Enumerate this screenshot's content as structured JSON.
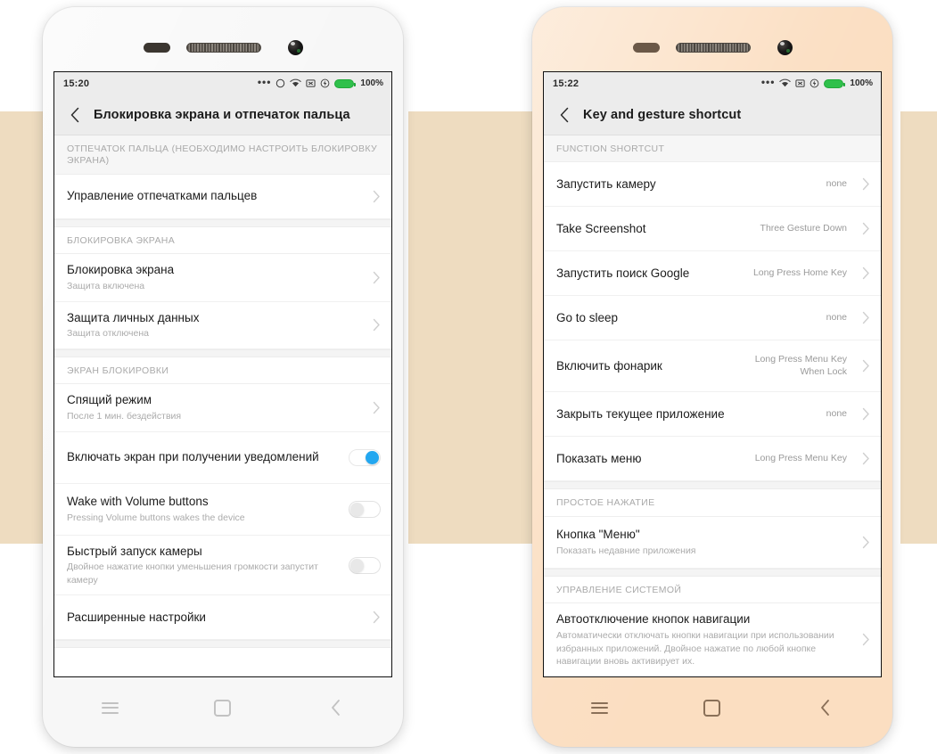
{
  "phones": [
    {
      "id": "left",
      "frame_color": "#f7f7f7",
      "status_bar": {
        "time": "15:20",
        "battery_percent": "100%",
        "icons": [
          "more-dots-icon",
          "alarm-circle-icon",
          "wifi-icon",
          "no-sim-icon",
          "charging-bolt-icon",
          "battery-icon"
        ]
      },
      "title": "Блокировка экрана и отпечаток пальца",
      "back_label": "back-chevron",
      "sections": [
        {
          "header": "ОТПЕЧАТОК ПАЛЬЦА (НЕОБХОДИМО НАСТРОИТЬ БЛОКИРОВКУ ЭКРАНА)",
          "rows": [
            {
              "title": "Управление отпечатками пальцев",
              "sub": "",
              "value": "",
              "control": "chevron"
            }
          ]
        },
        {
          "header": "БЛОКИРОВКА ЭКРАНА",
          "rows": [
            {
              "title": "Блокировка экрана",
              "sub": "Защита включена",
              "value": "",
              "control": "chevron"
            },
            {
              "title": "Защита личных данных",
              "sub": "Защита отключена",
              "value": "",
              "control": "chevron"
            }
          ]
        },
        {
          "header": "ЭКРАН БЛОКИРОВКИ",
          "rows": [
            {
              "title": "Спящий режим",
              "sub": "После 1 мин. бездействия",
              "value": "",
              "control": "chevron"
            },
            {
              "title": "Включать экран при получении уведомлений",
              "sub": "",
              "value": "",
              "control": "toggle-on"
            },
            {
              "title": "Wake with Volume buttons",
              "sub": "Pressing Volume buttons wakes the device",
              "value": "",
              "control": "toggle-off"
            },
            {
              "title": "Быстрый запуск камеры",
              "sub": "Двойное нажатие кнопки уменьшения громкости запустит камеру",
              "value": "",
              "control": "toggle-off"
            },
            {
              "title": "Расширенные настройки",
              "sub": "",
              "value": "",
              "control": "chevron"
            }
          ]
        }
      ],
      "nav": {
        "menu": "menu-icon",
        "home": "home-icon",
        "back": "back-icon"
      }
    },
    {
      "id": "right",
      "frame_color": "#fbdec1",
      "status_bar": {
        "time": "15:22",
        "battery_percent": "100%",
        "icons": [
          "more-dots-icon",
          "wifi-icon",
          "no-sim-icon",
          "charging-bolt-icon",
          "battery-icon"
        ]
      },
      "title": "Key and gesture shortcut",
      "back_label": "back-chevron",
      "sections": [
        {
          "header": "FUNCTION SHORTCUT",
          "rows": [
            {
              "title": "Запустить камеру",
              "sub": "",
              "value": "none",
              "control": "chevron"
            },
            {
              "title": "Take Screenshot",
              "sub": "",
              "value": "Three Gesture Down",
              "control": "chevron"
            },
            {
              "title": "Запустить поиск Google",
              "sub": "",
              "value": "Long Press Home Key",
              "control": "chevron"
            },
            {
              "title": "Go to sleep",
              "sub": "",
              "value": "none",
              "control": "chevron"
            },
            {
              "title": "Включить фонарик",
              "sub": "",
              "value": "Long Press Menu Key When Lock",
              "control": "chevron"
            },
            {
              "title": "Закрыть текущее приложение",
              "sub": "",
              "value": "none",
              "control": "chevron"
            },
            {
              "title": "Показать меню",
              "sub": "",
              "value": "Long Press Menu Key",
              "control": "chevron"
            }
          ]
        },
        {
          "header": "ПРОСТОЕ НАЖАТИЕ",
          "rows": [
            {
              "title": "Кнопка \"Меню\"",
              "sub": "Показать недавние приложения",
              "value": "",
              "control": "chevron"
            }
          ]
        },
        {
          "header": "УПРАВЛЕНИЕ СИСТЕМОЙ",
          "rows": [
            {
              "title": "Автоотключение кнопок навигации",
              "sub": "Автоматически отключать кнопки навигации при использовании избранных приложений. Двойное нажатие по любой кнопке навигации вновь активирует их.",
              "value": "",
              "control": "chevron"
            }
          ]
        }
      ],
      "nav": {
        "menu": "menu-icon",
        "home": "home-icon",
        "back": "back-icon"
      }
    }
  ],
  "decor": {
    "band_color": "#eedcc0",
    "page_background": "#ffffff"
  }
}
